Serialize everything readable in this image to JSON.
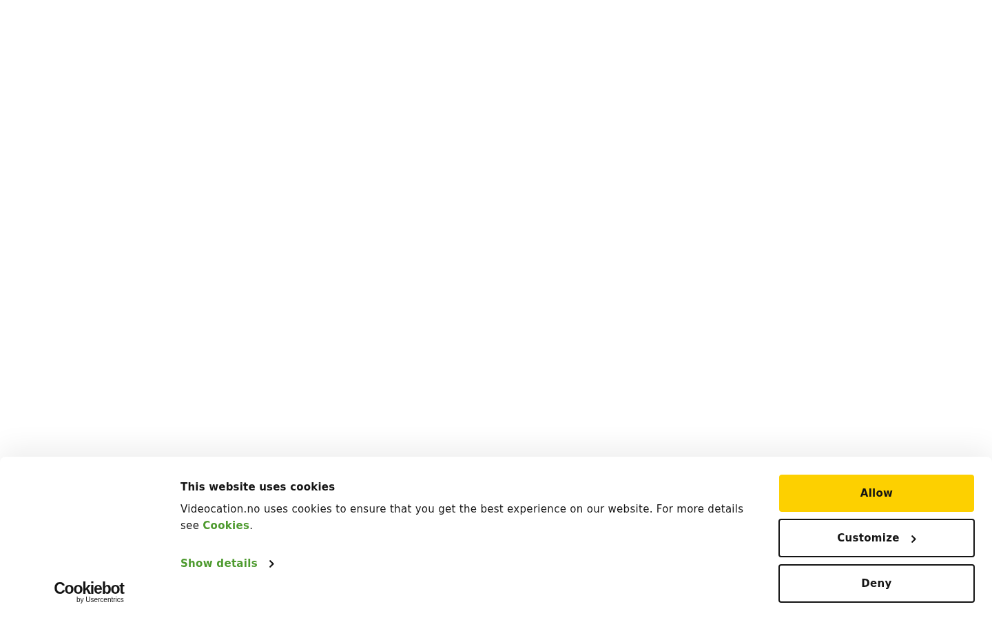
{
  "logo": {
    "wordmark": "Cookiebot",
    "tagline": "by Usercentrics"
  },
  "title": "This website uses cookies",
  "description": {
    "text": "Videocation.no uses cookies to ensure that you get the best experience on our website. For more details see ",
    "link": "Cookies",
    "end": "."
  },
  "details_link": "Show details",
  "buttons": [
    {
      "label": "Allow",
      "kind": "primary"
    },
    {
      "label": "Customize",
      "kind": "expand"
    },
    {
      "label": "Deny",
      "kind": "secondary"
    }
  ]
}
